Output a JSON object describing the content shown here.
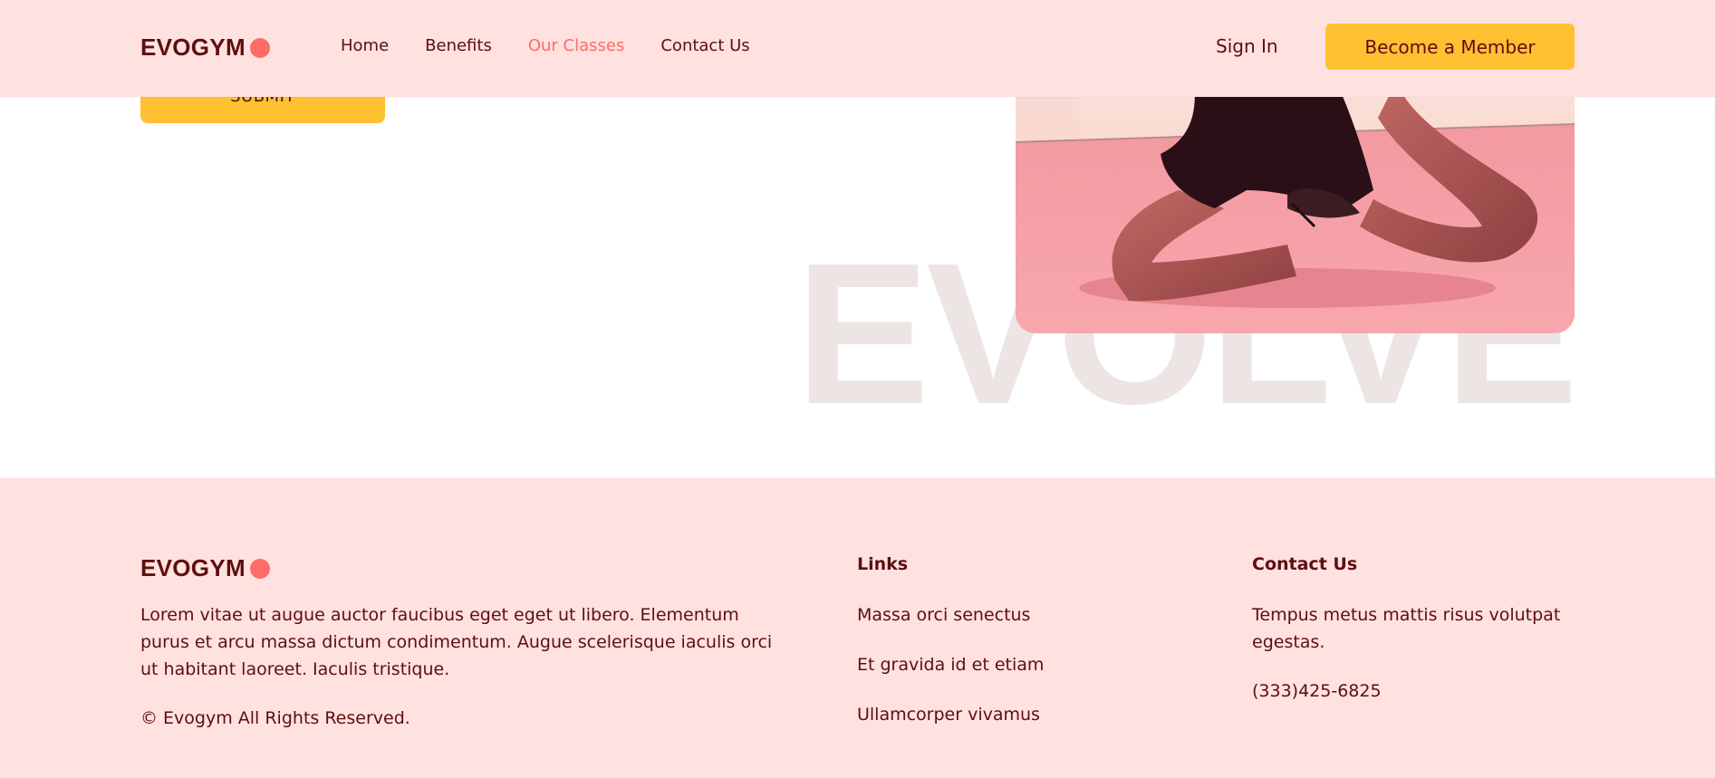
{
  "brand": {
    "name": "EVOGYM",
    "accent": "#ff6b66",
    "dark": "#5e0e0e",
    "cta": "#fec132",
    "pink_bg": "#ffe1e0"
  },
  "header": {
    "nav": [
      {
        "label": "Home"
      },
      {
        "label": "Benefits"
      },
      {
        "label": "Our Classes",
        "active": true
      },
      {
        "label": "Contact Us"
      }
    ],
    "sign_in": "Sign In",
    "member_button": "Become a Member"
  },
  "main": {
    "submit_label": "SUBMIT",
    "watermark": "EVOLVE"
  },
  "footer": {
    "description": "Lorem vitae ut augue auctor faucibus eget eget ut libero. Elementum purus et arcu massa dictum condimentum. Augue scelerisque iaculis orci ut habitant laoreet. Iaculis tristique.",
    "copyright": "© Evogym All Rights Reserved.",
    "links_title": "Links",
    "links": [
      "Massa orci senectus",
      "Et gravida id et etiam",
      "Ullamcorper vivamus"
    ],
    "contact_title": "Contact Us",
    "contact_text": "Tempus metus mattis risus volutpat egestas.",
    "phone": "(333)425-6825"
  }
}
